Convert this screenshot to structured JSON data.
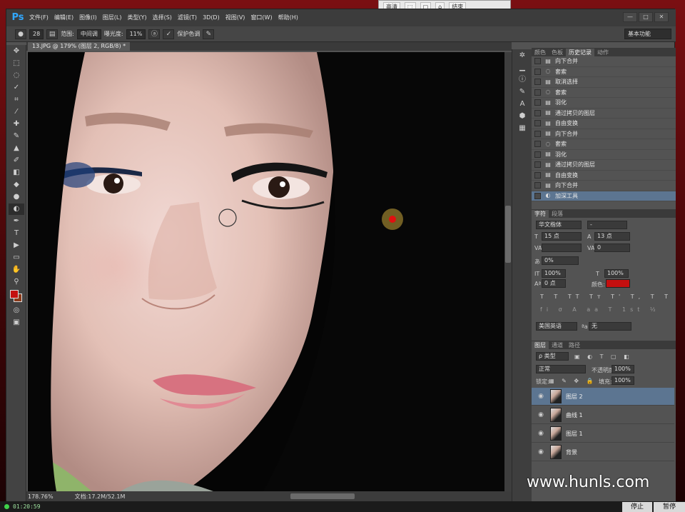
{
  "external_toolbar": {
    "buttons": [
      "高清",
      "⬚",
      "▢",
      "⌂",
      "结束"
    ]
  },
  "app": {
    "logo": "Ps",
    "menu": [
      "文件(F)",
      "编辑(E)",
      "图像(I)",
      "图层(L)",
      "类型(Y)",
      "选择(S)",
      "滤镜(T)",
      "3D(D)",
      "视图(V)",
      "窗口(W)",
      "帮助(H)"
    ],
    "window_controls": [
      "—",
      "□",
      "✕"
    ]
  },
  "options": {
    "brush_size": "28",
    "range_label": "范围:",
    "range_value": "中间调",
    "exposure_label": "曝光度:",
    "exposure_value": "11%",
    "protect_label": "保护色调",
    "workspace": "基本功能"
  },
  "document": {
    "tab": "13.JPG @ 179% (图层 2, RGB/8) *",
    "zoom": "178.76%",
    "doc_size": "文档:17.2M/52.1M"
  },
  "panels": {
    "history_tabs": [
      "颜色",
      "色板",
      "历史记录",
      "动作"
    ],
    "history_active": "历史记录",
    "history": [
      {
        "icon": "merge",
        "name": "向下合并"
      },
      {
        "icon": "lasso",
        "name": "套索"
      },
      {
        "icon": "layer",
        "name": "取消选择"
      },
      {
        "icon": "lasso",
        "name": "套索"
      },
      {
        "icon": "layer",
        "name": "羽化"
      },
      {
        "icon": "layer",
        "name": "通过拷贝的图层"
      },
      {
        "icon": "layer",
        "name": "自由变换"
      },
      {
        "icon": "layer",
        "name": "向下合并"
      },
      {
        "icon": "lasso",
        "name": "套索"
      },
      {
        "icon": "layer",
        "name": "羽化"
      },
      {
        "icon": "layer",
        "name": "通过拷贝的图层"
      },
      {
        "icon": "layer",
        "name": "自由变换"
      },
      {
        "icon": "layer",
        "name": "向下合并"
      },
      {
        "icon": "burn",
        "name": "加深工具"
      }
    ],
    "char_tabs": [
      "字符",
      "段落"
    ],
    "char_active": "字符",
    "font_family": "华文楷体",
    "font_style": "-",
    "font_size": "15 点",
    "leading": "13 点",
    "tracking": "0",
    "kerning_value": "0%",
    "vscale": "100%",
    "hscale": "100%",
    "baseline": "0 点",
    "color_label": "颜色:",
    "text_color": "#c40f0f",
    "language": "美国英语",
    "aa_label": "ªa",
    "antialias": "无",
    "layer_tabs": [
      "图层",
      "通道",
      "路径"
    ],
    "layer_active": "图层",
    "filter_type": "ρ 类型",
    "blend_mode": "正常",
    "opacity_label": "不透明度:",
    "opacity": "100%",
    "lock_label": "锁定:",
    "fill_label": "填充:",
    "fill": "100%",
    "layers": [
      {
        "name": "图层 2",
        "selected": true
      },
      {
        "name": "曲线 1",
        "selected": false
      },
      {
        "name": "图层 1",
        "selected": false
      },
      {
        "name": "背景",
        "selected": false
      }
    ]
  },
  "watermark": "www.hunls.com",
  "taskbar": {
    "clock": "01:20:59",
    "stop": "停止",
    "pause": "暂停"
  }
}
